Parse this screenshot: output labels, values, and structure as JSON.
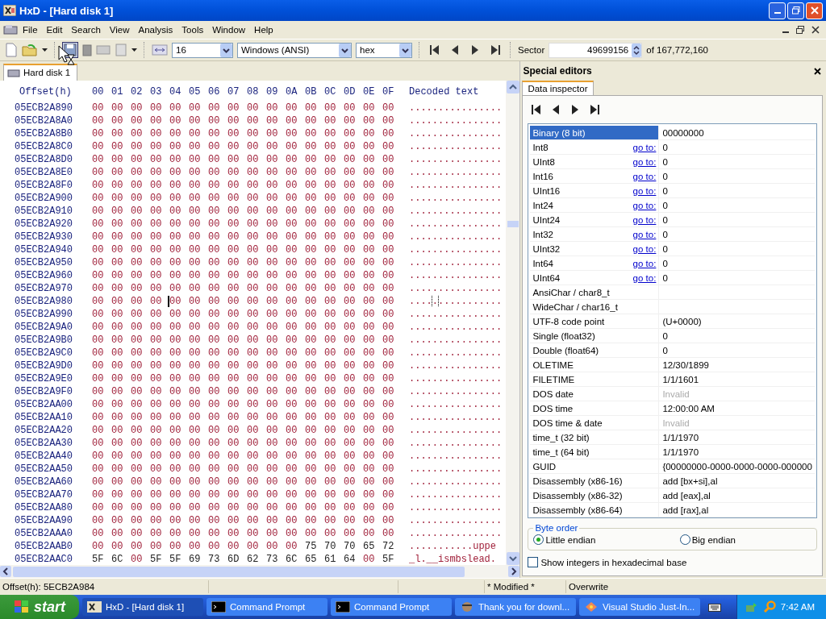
{
  "window": {
    "title": "HxD - [Hard disk 1]"
  },
  "menu": [
    "File",
    "Edit",
    "Search",
    "View",
    "Analysis",
    "Tools",
    "Window",
    "Help"
  ],
  "toolbar": {
    "bytes_per_row": "16",
    "charset": "Windows (ANSI)",
    "offset_base": "hex",
    "sector_label": "Sector",
    "sector": "49699156",
    "sector_total": "of 167,772,160"
  },
  "tabs": [
    {
      "label": "Hard disk 1",
      "selected": true
    }
  ],
  "hex": {
    "offset_header": "Offset(h)",
    "columns": [
      "00",
      "01",
      "02",
      "03",
      "04",
      "05",
      "06",
      "07",
      "08",
      "09",
      "0A",
      "0B",
      "0C",
      "0D",
      "0E",
      "0F"
    ],
    "text_header": "Decoded text",
    "rows": [
      {
        "offset": "05ECB2A890",
        "bytes": "00 00 00 00 00 00 00 00 00 00 00 00 00 00 00 00",
        "text": "................",
        "caret": false
      },
      {
        "offset": "05ECB2A8A0",
        "bytes": "00 00 00 00 00 00 00 00 00 00 00 00 00 00 00 00",
        "text": "................",
        "caret": false
      },
      {
        "offset": "05ECB2A8B0",
        "bytes": "00 00 00 00 00 00 00 00 00 00 00 00 00 00 00 00",
        "text": "................",
        "caret": false
      },
      {
        "offset": "05ECB2A8C0",
        "bytes": "00 00 00 00 00 00 00 00 00 00 00 00 00 00 00 00",
        "text": "................",
        "caret": false
      },
      {
        "offset": "05ECB2A8D0",
        "bytes": "00 00 00 00 00 00 00 00 00 00 00 00 00 00 00 00",
        "text": "................",
        "caret": false
      },
      {
        "offset": "05ECB2A8E0",
        "bytes": "00 00 00 00 00 00 00 00 00 00 00 00 00 00 00 00",
        "text": "................",
        "caret": false
      },
      {
        "offset": "05ECB2A8F0",
        "bytes": "00 00 00 00 00 00 00 00 00 00 00 00 00 00 00 00",
        "text": "................",
        "caret": false
      },
      {
        "offset": "05ECB2A900",
        "bytes": "00 00 00 00 00 00 00 00 00 00 00 00 00 00 00 00",
        "text": "................",
        "caret": false
      },
      {
        "offset": "05ECB2A910",
        "bytes": "00 00 00 00 00 00 00 00 00 00 00 00 00 00 00 00",
        "text": "................",
        "caret": false
      },
      {
        "offset": "05ECB2A920",
        "bytes": "00 00 00 00 00 00 00 00 00 00 00 00 00 00 00 00",
        "text": "................",
        "caret": false
      },
      {
        "offset": "05ECB2A930",
        "bytes": "00 00 00 00 00 00 00 00 00 00 00 00 00 00 00 00",
        "text": "................",
        "caret": false
      },
      {
        "offset": "05ECB2A940",
        "bytes": "00 00 00 00 00 00 00 00 00 00 00 00 00 00 00 00",
        "text": "................",
        "caret": false
      },
      {
        "offset": "05ECB2A950",
        "bytes": "00 00 00 00 00 00 00 00 00 00 00 00 00 00 00 00",
        "text": "................",
        "caret": false
      },
      {
        "offset": "05ECB2A960",
        "bytes": "00 00 00 00 00 00 00 00 00 00 00 00 00 00 00 00",
        "text": "................",
        "caret": false
      },
      {
        "offset": "05ECB2A970",
        "bytes": "00 00 00 00 00 00 00 00 00 00 00 00 00 00 00 00",
        "text": "................",
        "caret": false
      },
      {
        "offset": "05ECB2A980",
        "bytes": "00 00 00 00",
        "bytes_after_caret": "00 00 00 00 00 00 00 00 00 00 00 00",
        "text": "................",
        "caret": true
      },
      {
        "offset": "05ECB2A990",
        "bytes": "00 00 00 00 00 00 00 00 00 00 00 00 00 00 00 00",
        "text": "................",
        "caret": false
      },
      {
        "offset": "05ECB2A9A0",
        "bytes": "00 00 00 00 00 00 00 00 00 00 00 00 00 00 00 00",
        "text": "................",
        "caret": false
      },
      {
        "offset": "05ECB2A9B0",
        "bytes": "00 00 00 00 00 00 00 00 00 00 00 00 00 00 00 00",
        "text": "................",
        "caret": false
      },
      {
        "offset": "05ECB2A9C0",
        "bytes": "00 00 00 00 00 00 00 00 00 00 00 00 00 00 00 00",
        "text": "................",
        "caret": false
      },
      {
        "offset": "05ECB2A9D0",
        "bytes": "00 00 00 00 00 00 00 00 00 00 00 00 00 00 00 00",
        "text": "................",
        "caret": false
      },
      {
        "offset": "05ECB2A9E0",
        "bytes": "00 00 00 00 00 00 00 00 00 00 00 00 00 00 00 00",
        "text": "................",
        "caret": false
      },
      {
        "offset": "05ECB2A9F0",
        "bytes": "00 00 00 00 00 00 00 00 00 00 00 00 00 00 00 00",
        "text": "................",
        "caret": false
      },
      {
        "offset": "05ECB2AA00",
        "bytes": "00 00 00 00 00 00 00 00 00 00 00 00 00 00 00 00",
        "text": "................",
        "caret": false
      },
      {
        "offset": "05ECB2AA10",
        "bytes": "00 00 00 00 00 00 00 00 00 00 00 00 00 00 00 00",
        "text": "................",
        "caret": false
      },
      {
        "offset": "05ECB2AA20",
        "bytes": "00 00 00 00 00 00 00 00 00 00 00 00 00 00 00 00",
        "text": "................",
        "caret": false
      },
      {
        "offset": "05ECB2AA30",
        "bytes": "00 00 00 00 00 00 00 00 00 00 00 00 00 00 00 00",
        "text": "................",
        "caret": false
      },
      {
        "offset": "05ECB2AA40",
        "bytes": "00 00 00 00 00 00 00 00 00 00 00 00 00 00 00 00",
        "text": "................",
        "caret": false
      },
      {
        "offset": "05ECB2AA50",
        "bytes": "00 00 00 00 00 00 00 00 00 00 00 00 00 00 00 00",
        "text": "................",
        "caret": false
      },
      {
        "offset": "05ECB2AA60",
        "bytes": "00 00 00 00 00 00 00 00 00 00 00 00 00 00 00 00",
        "text": "................",
        "caret": false
      },
      {
        "offset": "05ECB2AA70",
        "bytes": "00 00 00 00 00 00 00 00 00 00 00 00 00 00 00 00",
        "text": "................",
        "caret": false
      },
      {
        "offset": "05ECB2AA80",
        "bytes": "00 00 00 00 00 00 00 00 00 00 00 00 00 00 00 00",
        "text": "................",
        "caret": false
      },
      {
        "offset": "05ECB2AA90",
        "bytes": "00 00 00 00 00 00 00 00 00 00 00 00 00 00 00 00",
        "text": "................",
        "caret": false
      },
      {
        "offset": "05ECB2AAA0",
        "bytes": "00 00 00 00 00 00 00 00 00 00 00 00 00 00 00 00",
        "text": "................",
        "caret": false
      },
      {
        "offset": "05ECB2AAB0",
        "bytes": "00 00 00 00 00 00 00 00 00 00 00 75 70 70 65 72",
        "text": "...........uppe",
        "caret": false
      },
      {
        "offset": "05ECB2AAC0",
        "bytes": "5F 6C 00 5F 5F 69 73 6D 62 73 6C 65 61 64 00 5F",
        "text": "_l.__ismbslead.",
        "caret": false
      }
    ]
  },
  "special_editors": {
    "title": "Special editors",
    "tabs": [
      {
        "label": "Data inspector",
        "selected": true
      }
    ],
    "fields": [
      {
        "name": "Binary (8 bit)",
        "value": "00000000",
        "selected": true
      },
      {
        "name": "Int8",
        "goto": "go to:",
        "value": "0",
        "selected": false
      },
      {
        "name": "UInt8",
        "goto": "go to:",
        "value": "0",
        "selected": false
      },
      {
        "name": "Int16",
        "goto": "go to:",
        "value": "0",
        "selected": false
      },
      {
        "name": "UInt16",
        "goto": "go to:",
        "value": "0",
        "selected": false
      },
      {
        "name": "Int24",
        "goto": "go to:",
        "value": "0",
        "selected": false
      },
      {
        "name": "UInt24",
        "goto": "go to:",
        "value": "0",
        "selected": false
      },
      {
        "name": "Int32",
        "goto": "go to:",
        "value": "0",
        "selected": false
      },
      {
        "name": "UInt32",
        "goto": "go to:",
        "value": "0",
        "selected": false
      },
      {
        "name": "Int64",
        "goto": "go to:",
        "value": "0",
        "selected": false
      },
      {
        "name": "UInt64",
        "goto": "go to:",
        "value": "0",
        "selected": false
      },
      {
        "name": "AnsiChar / char8_t",
        "selected": false
      },
      {
        "name": "WideChar / char16_t",
        "selected": false
      },
      {
        "name": "UTF-8 code point",
        "value": " (U+0000)",
        "selected": false
      },
      {
        "name": "Single (float32)",
        "value": "0",
        "selected": false
      },
      {
        "name": "Double (float64)",
        "value": "0",
        "selected": false
      },
      {
        "name": "OLETIME",
        "value": "12/30/1899",
        "selected": false
      },
      {
        "name": "FILETIME",
        "value": "1/1/1601",
        "selected": false
      },
      {
        "name": "DOS date",
        "value": "Invalid",
        "disabled": true,
        "selected": false
      },
      {
        "name": "DOS time",
        "value": "12:00:00 AM",
        "selected": false
      },
      {
        "name": "DOS time & date",
        "value": "Invalid",
        "disabled": true,
        "selected": false
      },
      {
        "name": "time_t (32 bit)",
        "value": "1/1/1970",
        "selected": false
      },
      {
        "name": "time_t (64 bit)",
        "value": "1/1/1970",
        "selected": false
      },
      {
        "name": "GUID",
        "value": "{00000000-0000-0000-0000-000000",
        "selected": false
      },
      {
        "name": "Disassembly (x86-16)",
        "value": "add [bx+si],al",
        "selected": false
      },
      {
        "name": "Disassembly (x86-32)",
        "value": "add [eax],al",
        "selected": false
      },
      {
        "name": "Disassembly (x86-64)",
        "value": "add [rax],al",
        "selected": false
      }
    ],
    "byte_order": {
      "title": "Byte order",
      "options": [
        {
          "label": "Little endian",
          "selected": true
        },
        {
          "label": "Big endian",
          "selected": false
        }
      ]
    },
    "hex_integers": {
      "label": "Show integers in hexadecimal base",
      "checked": false
    }
  },
  "status_bar": {
    "offset": "Offset(h): 5ECB2A984",
    "modified": "* Modified *",
    "mode": "Overwrite"
  },
  "taskbar": {
    "start": "start",
    "items": [
      {
        "label": "HxD - [Hard disk 1]",
        "kind": "hxd",
        "selected": true
      },
      {
        "label": "Command Prompt",
        "kind": "console",
        "selected": false
      },
      {
        "label": "Command Prompt",
        "kind": "console",
        "selected": false
      },
      {
        "label": "Thank you for downl...",
        "kind": "browser",
        "selected": false
      },
      {
        "label": "Visual Studio Just-In...",
        "kind": "debugger",
        "selected": false
      }
    ],
    "clock": "7:42 AM"
  }
}
